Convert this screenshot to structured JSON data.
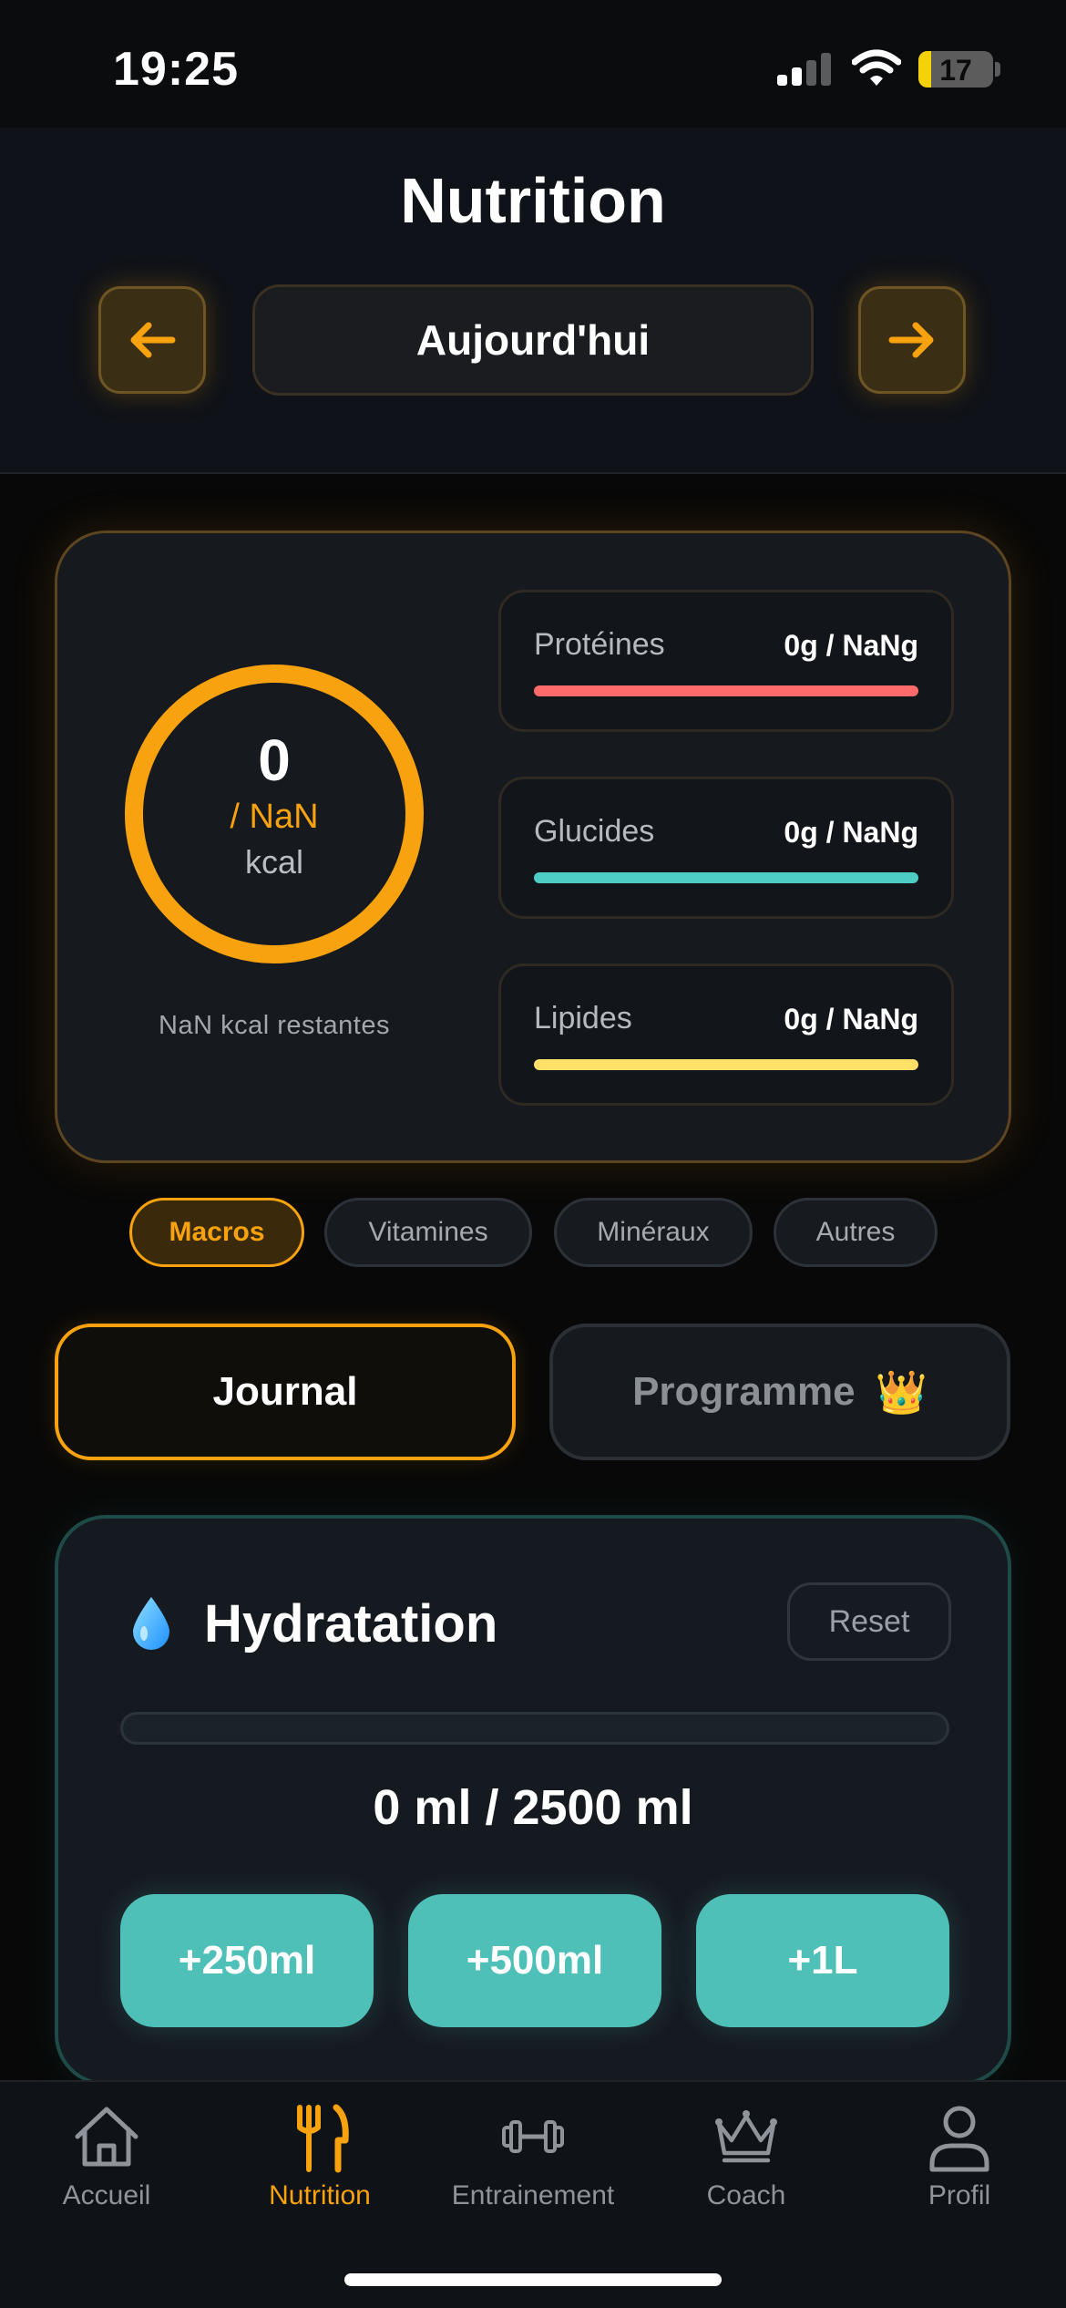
{
  "status_bar": {
    "time": "19:25",
    "battery": "17",
    "battery_fraction": 0.17
  },
  "header": {
    "title": "Nutrition",
    "date_label": "Aujourd'hui",
    "prev_icon": "arrow-left-icon",
    "next_icon": "arrow-right-icon"
  },
  "calories": {
    "value": "0",
    "target": "/ NaN",
    "unit": "kcal",
    "remaining": "NaN kcal restantes",
    "ring_color": "#f7a20e"
  },
  "macros": [
    {
      "name": "Protéines",
      "value": "0g / NaNg",
      "color": "#ff6b6b"
    },
    {
      "name": "Glucides",
      "value": "0g / NaNg",
      "color": "#4ecdc4"
    },
    {
      "name": "Lipides",
      "value": "0g / NaNg",
      "color": "#ffe066"
    }
  ],
  "categories": [
    {
      "label": "Macros",
      "active": true
    },
    {
      "label": "Vitamines",
      "active": false
    },
    {
      "label": "Minéraux",
      "active": false
    },
    {
      "label": "Autres",
      "active": false
    }
  ],
  "modes": {
    "journal": "Journal",
    "programme": "Programme",
    "programme_icon": "👑"
  },
  "hydration": {
    "title": "Hydratation",
    "icon": "water-drop-icon",
    "reset_label": "Reset",
    "progress_fraction": 0,
    "amount_text": "0 ml / 2500 ml",
    "buttons": [
      "+250ml",
      "+500ml",
      "+1L"
    ],
    "accent": "#4ecdc4"
  },
  "tab_bar": [
    {
      "label": "Accueil",
      "icon": "home-icon",
      "active": false
    },
    {
      "label": "Nutrition",
      "icon": "fork-knife-icon",
      "active": true
    },
    {
      "label": "Entrainement",
      "icon": "dumbbell-icon",
      "active": false
    },
    {
      "label": "Coach",
      "icon": "crown-icon",
      "active": false
    },
    {
      "label": "Profil",
      "icon": "person-icon",
      "active": false
    }
  ]
}
